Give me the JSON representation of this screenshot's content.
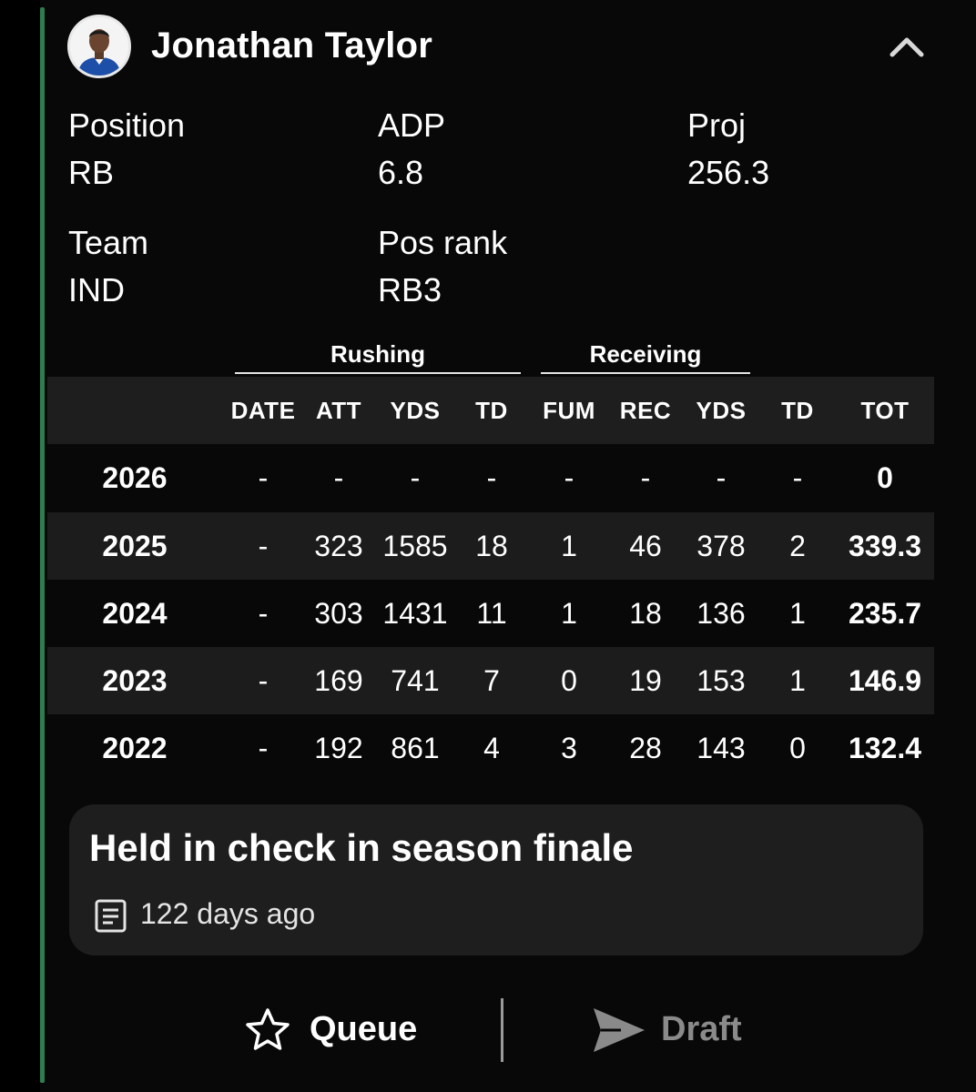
{
  "player": {
    "name": "Jonathan Taylor",
    "avatar_icon": "player-headshot"
  },
  "info": {
    "position_label": "Position",
    "position_value": "RB",
    "adp_label": "ADP",
    "adp_value": "6.8",
    "proj_label": "Proj",
    "proj_value": "256.3",
    "team_label": "Team",
    "team_value": "IND",
    "posrank_label": "Pos rank",
    "posrank_value": "RB3"
  },
  "stats": {
    "groups": [
      "Rushing",
      "Receiving"
    ],
    "headers": [
      "DATE",
      "ATT",
      "YDS",
      "TD",
      "FUM",
      "REC",
      "YDS",
      "TD",
      "TOT"
    ],
    "rows": [
      {
        "year": "2026",
        "cells": [
          "-",
          "-",
          "-",
          "-",
          "-",
          "-",
          "-",
          "-",
          "0"
        ]
      },
      {
        "year": "2025",
        "cells": [
          "-",
          "323",
          "1585",
          "18",
          "1",
          "46",
          "378",
          "2",
          "339.3"
        ]
      },
      {
        "year": "2024",
        "cells": [
          "-",
          "303",
          "1431",
          "11",
          "1",
          "18",
          "136",
          "1",
          "235.7"
        ]
      },
      {
        "year": "2023",
        "cells": [
          "-",
          "169",
          "741",
          "7",
          "0",
          "19",
          "153",
          "1",
          "146.9"
        ]
      },
      {
        "year": "2022",
        "cells": [
          "-",
          "192",
          "861",
          "4",
          "3",
          "28",
          "143",
          "0",
          "132.4"
        ]
      }
    ]
  },
  "news": {
    "title": "Held in check in season finale",
    "time": "122 days ago",
    "icon": "article-icon"
  },
  "actions": {
    "queue_label": "Queue",
    "draft_label": "Draft"
  },
  "colors": {
    "accent": "#2e7d4f",
    "background": "#080808",
    "band": "#1c1c1c",
    "disabled": "#8a8a8a"
  }
}
